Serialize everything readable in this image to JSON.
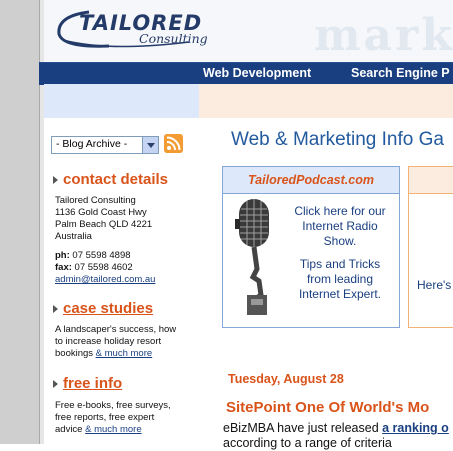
{
  "header": {
    "logo_name": "TAILORED",
    "logo_sub": "Consulting",
    "watermark": "marketi"
  },
  "nav": {
    "items": [
      "Web Development",
      "Search Engine P"
    ]
  },
  "sidebar": {
    "blog_archive": "- Blog Archive -",
    "contact": {
      "title": "contact details",
      "lines": [
        "Tailored Consulting",
        "1136 Gold Coast Hwy",
        "Palm Beach QLD 4221",
        "Australia"
      ],
      "phone_label": "ph:",
      "phone": "07 5598 4898",
      "fax_label": "fax:",
      "fax": "07 5598 4602",
      "email": "admin@tailored.com.au"
    },
    "case_studies": {
      "title": "case studies",
      "lines": [
        "A landscaper's success, how",
        "to increase holiday resort",
        "bookings"
      ],
      "more": "& much more"
    },
    "free_info": {
      "title": "free info",
      "lines": [
        "Free e-books, free surveys,",
        "free reports, free expert",
        "advice"
      ],
      "more": "& much more"
    }
  },
  "main": {
    "title": "Web & Marketing Info Ga",
    "podcast": {
      "header": "TailoredPodcast.com",
      "lines": [
        "Click here for our",
        "Internet Radio",
        "Show.",
        "",
        "Tips and Tricks",
        "from leading",
        "Internet Expert."
      ]
    },
    "side_box_text": "Here's",
    "post": {
      "date": "Tuesday, August 28",
      "title": "SitePoint One Of World's Mo",
      "text_before": "eBizMBA have just released ",
      "link": "a ranking o",
      "text_line2": "according to a range of criteria"
    }
  },
  "colors": {
    "nav_bg": "#1a3f80",
    "accent_orange": "#d9541b",
    "title_blue": "#235a9e"
  }
}
